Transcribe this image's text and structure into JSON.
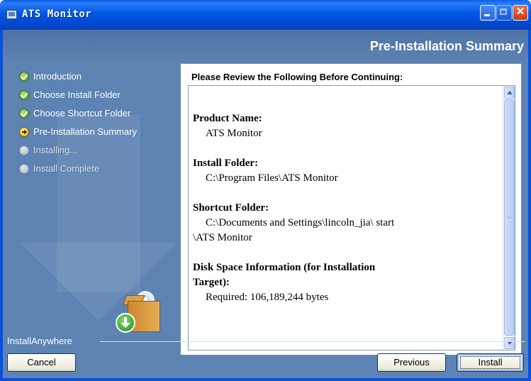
{
  "window": {
    "title": "ATS Monitor"
  },
  "header": {
    "page_title": "Pre-Installation Summary"
  },
  "steps": [
    {
      "label": "Introduction",
      "state": "done"
    },
    {
      "label": "Choose Install Folder",
      "state": "done"
    },
    {
      "label": "Choose Shortcut Folder",
      "state": "done"
    },
    {
      "label": "Pre-Installation Summary",
      "state": "current"
    },
    {
      "label": "Installing...",
      "state": "pending"
    },
    {
      "label": "Install Complete",
      "state": "pending"
    }
  ],
  "summary": {
    "heading": "Please Review the Following Before Continuing:",
    "product_name_label": "Product Name:",
    "product_name_value": "ATS Monitor",
    "install_folder_label": "Install Folder:",
    "install_folder_value": "C:\\Program Files\\ATS Monitor",
    "shortcut_folder_label": "Shortcut Folder:",
    "shortcut_folder_value_line1": "C:\\Documents and Settings\\lincoln_jia\\ start",
    "shortcut_folder_value_line2": "\\ATS Monitor",
    "disk_space_label_line1": "Disk Space Information (for Installation",
    "disk_space_label_line2": "Target):",
    "disk_space_value": "Required: 106,189,244 bytes"
  },
  "footer": {
    "brand": "InstallAnywhere",
    "cancel_label": "Cancel",
    "previous_label": "Previous",
    "install_label": "Install"
  },
  "colors": {
    "titlebar": "#0058e6",
    "sidebar_bg": "#5c83b1",
    "close_button": "#c83a18"
  },
  "icons": {
    "step_done": "check-circle-icon",
    "step_current": "arrow-circle-icon",
    "step_pending": "empty-circle-icon"
  }
}
